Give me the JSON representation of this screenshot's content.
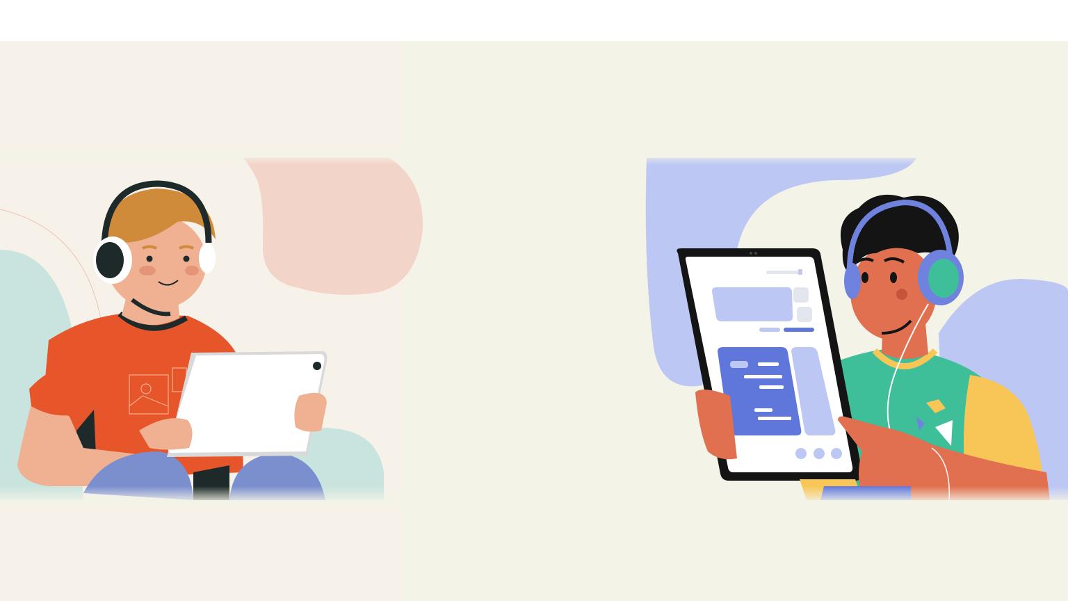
{
  "scene": {
    "background_color": "#f3f3e7",
    "left_panel_color": "#f6f2ea",
    "figures": [
      {
        "description_icon": "person-with-headphones-holding-tablet-icon",
        "shirt_color": "#e6562a",
        "hair_color": "#cf8a3a",
        "skin_color": "#efb192",
        "pants_color": "#7b8fcf",
        "blob_color": "#f3d4c8",
        "accent_blob_color": "#c9e4de"
      },
      {
        "description_icon": "person-with-headphones-pointing-at-tablet-icon",
        "shirt_color": "#3fbe9a",
        "sleeve_color": "#f8c656",
        "hair_color": "#141414",
        "skin_color": "#e0704f",
        "headphone_color": "#6f82dd",
        "blob_color": "#bcc7f3",
        "screen_accent_color": "#5f77db"
      }
    ]
  }
}
